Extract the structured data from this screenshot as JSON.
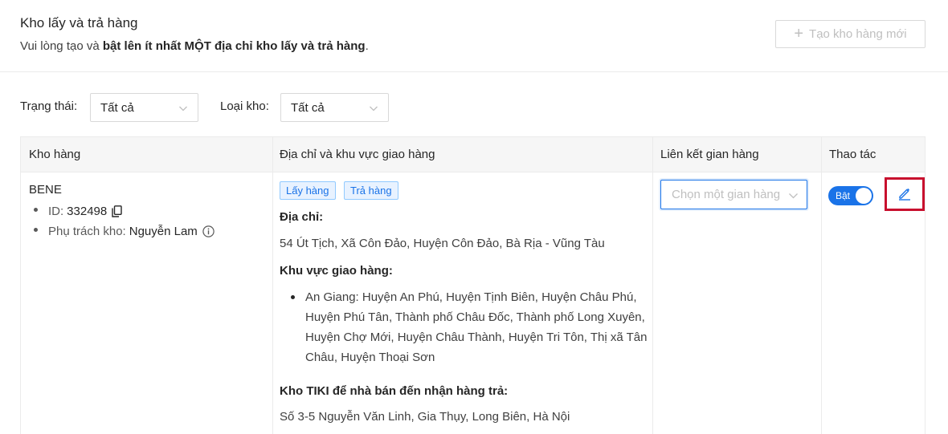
{
  "header": {
    "title": "Kho lấy và trả hàng",
    "desc_prefix": "Vui lòng tạo và ",
    "desc_bold": "bật lên ít nhất MỘT địa chỉ kho lấy và trả hàng",
    "desc_suffix": ".",
    "create_button": "Tạo kho hàng mới"
  },
  "filters": {
    "status_label": "Trạng thái:",
    "status_value": "Tất cả",
    "type_label": "Loại kho:",
    "type_value": "Tất cả"
  },
  "table": {
    "columns": [
      "Kho hàng",
      "Địa chỉ và khu vực giao hàng",
      "Liên kết gian hàng",
      "Thao tác"
    ],
    "row": {
      "warehouse_name": "BENE",
      "id_label": "ID:",
      "id_value": "332498",
      "manager_label": "Phụ trách kho:",
      "manager_value": "Nguyễn Lam",
      "tags": [
        "Lấy hàng",
        "Trả hàng"
      ],
      "address_label": "Địa chỉ:",
      "address_value": "54 Út Tịch, Xã Côn Đảo, Huyện Côn Đảo, Bà Rịa - Vũng Tàu",
      "area_label": "Khu vực giao hàng:",
      "area_items": [
        "An Giang: Huyện An Phú, Huyện Tịnh Biên, Huyện Châu Phú, Huyện Phú Tân, Thành phố Châu Đốc, Thành phố Long Xuyên, Huyện Chợ Mới, Huyện Châu Thành, Huyện Tri Tôn, Thị xã Tân Châu, Huyện Thoại Sơn"
      ],
      "return_label": "Kho TIKI để nhà bán đến nhận hàng trả:",
      "return_value": "Số 3-5 Nguyễn Văn Linh, Gia Thụy, Long Biên, Hà Nội",
      "store_placeholder": "Chọn một gian hàng",
      "toggle_label": "Bật",
      "toggle_on": true
    }
  },
  "colors": {
    "accent": "#1a73e8",
    "highlight_border": "#c8102e"
  }
}
